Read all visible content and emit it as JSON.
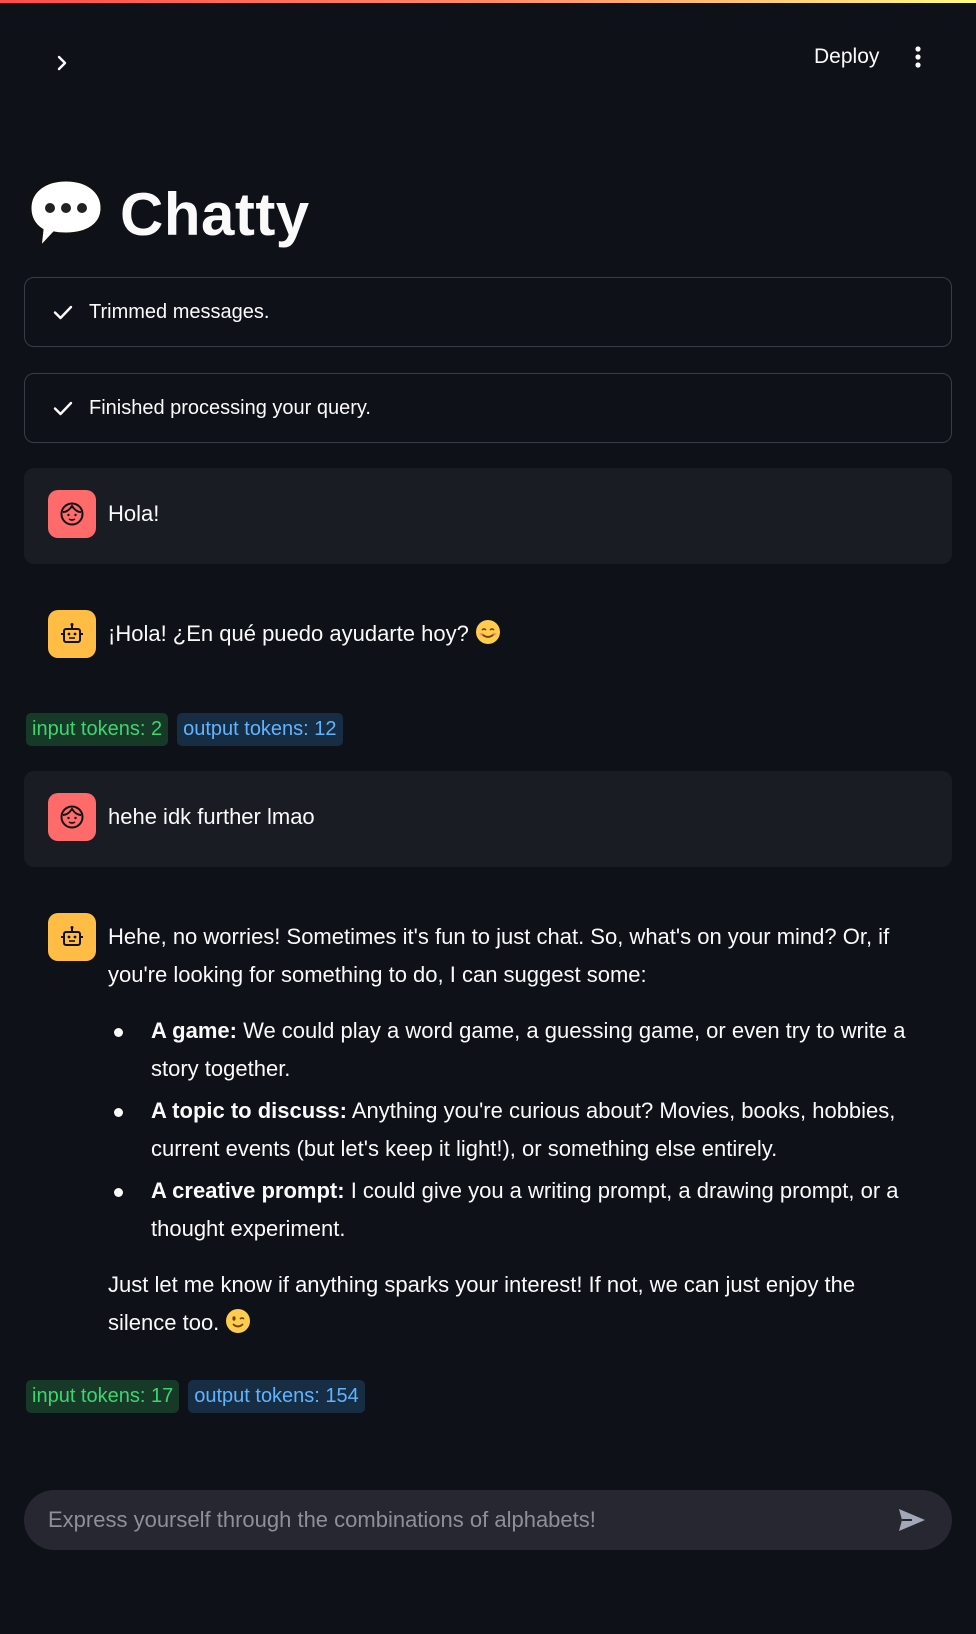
{
  "header": {
    "deploy_label": "Deploy"
  },
  "title": {
    "text": "Chatty",
    "emoji": "speech-balloon-icon"
  },
  "statuses": [
    {
      "text": "Trimmed messages.",
      "icon": "check-icon"
    },
    {
      "text": "Finished processing your query.",
      "icon": "check-icon"
    }
  ],
  "messages": [
    {
      "role": "user",
      "text": "Hola!"
    },
    {
      "role": "assistant",
      "text": "¡Hola! ¿En qué puedo ayudarte hoy?",
      "emoji": "smiling-face-icon"
    },
    {
      "role": "user",
      "text": "hehe idk further lmao"
    },
    {
      "role": "assistant",
      "intro": "Hehe, no worries! Sometimes it's fun to just chat. So, what's on your mind? Or, if you're looking for something to do, I can suggest some:",
      "items": [
        {
          "bold": "A game:",
          "text": " We could play a word game, a guessing game, or even try to write a story together."
        },
        {
          "bold": "A topic to discuss:",
          "text": " Anything you're curious about? Movies, books, hobbies, current events (but let's keep it light!), or something else entirely."
        },
        {
          "bold": "A creative prompt:",
          "text": " I could give you a writing prompt, a drawing prompt, or a thought experiment."
        }
      ],
      "outro": "Just let me know if anything sparks your interest! If not, we can just enjoy the silence too.",
      "emoji": "winking-face-icon"
    }
  ],
  "tokens": [
    {
      "input": "input tokens: 2",
      "output": "output tokens: 12"
    },
    {
      "input": "input tokens: 17",
      "output": "output tokens: 154"
    }
  ],
  "chat_input": {
    "placeholder": "Express yourself through the combinations of alphabets!"
  },
  "colors": {
    "background": "#0e1117",
    "user_avatar": "#ff6b6b",
    "bot_avatar": "#ffbd45",
    "input_badge_text": "#3dd56d",
    "output_badge_text": "#60b4ff"
  }
}
